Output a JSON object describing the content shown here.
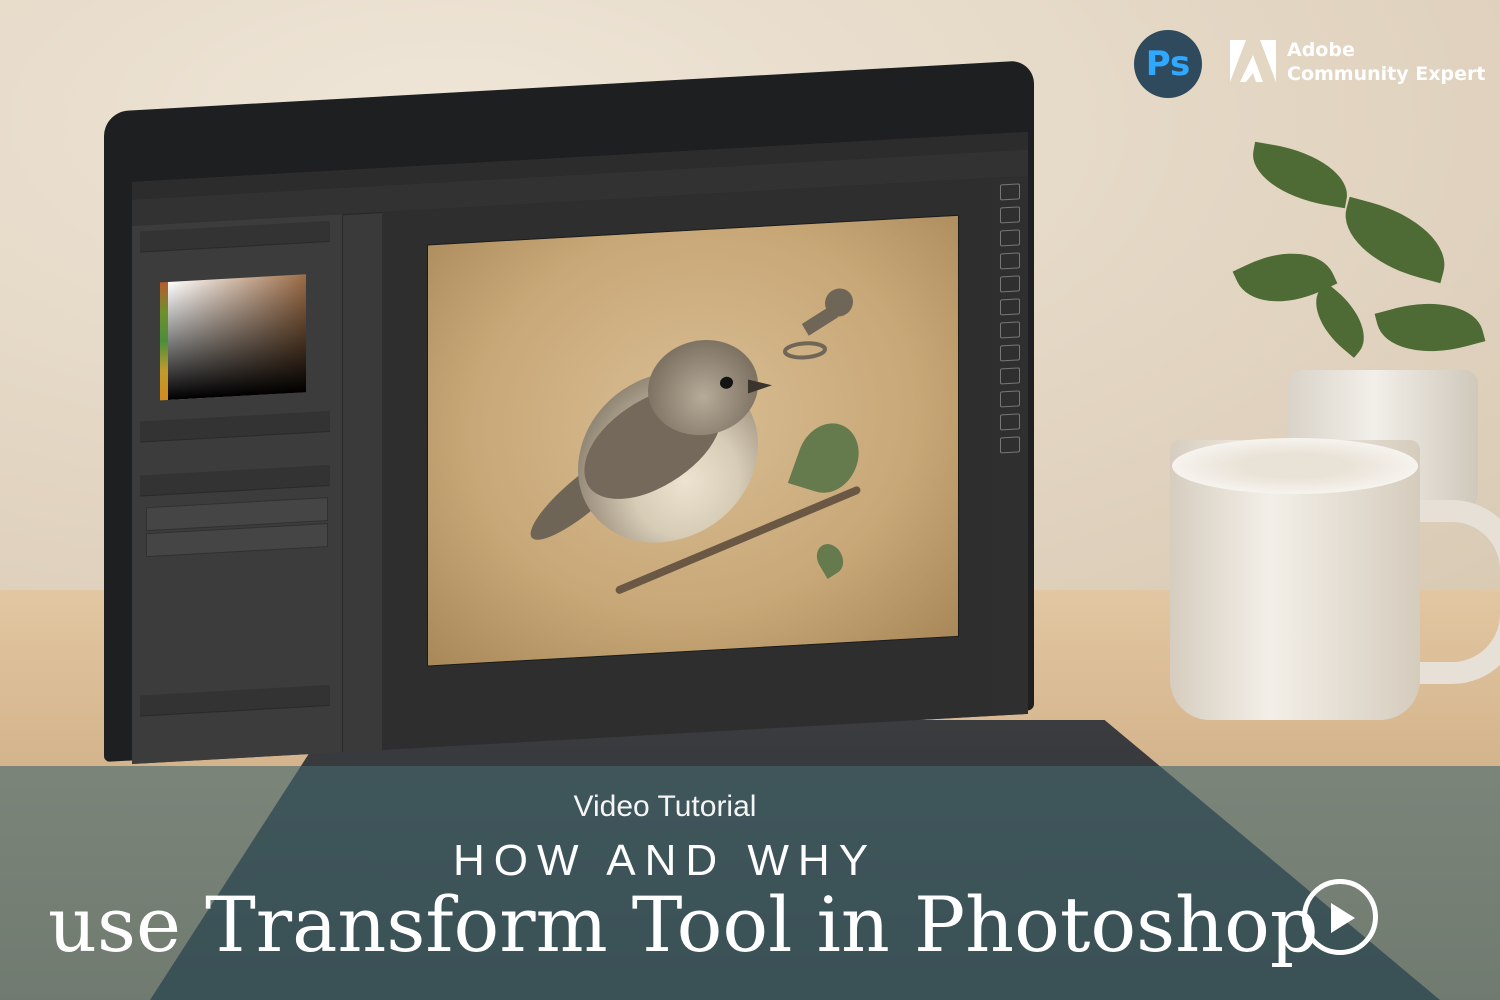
{
  "brand": {
    "ps_logo_text": "Ps",
    "adobe_line1": "Adobe",
    "adobe_line2": "Community Expert",
    "adobe_red": "#ffffff"
  },
  "overlay": {
    "subtitle": "Video Tutorial",
    "heading": "HOW AND WHY",
    "title": "use Transform Tool in Photoshop",
    "band_color": "#43686e"
  },
  "icons": {
    "play": "play-circle-icon",
    "photoshop": "photoshop-logo-icon",
    "adobe": "adobe-logo-icon"
  }
}
